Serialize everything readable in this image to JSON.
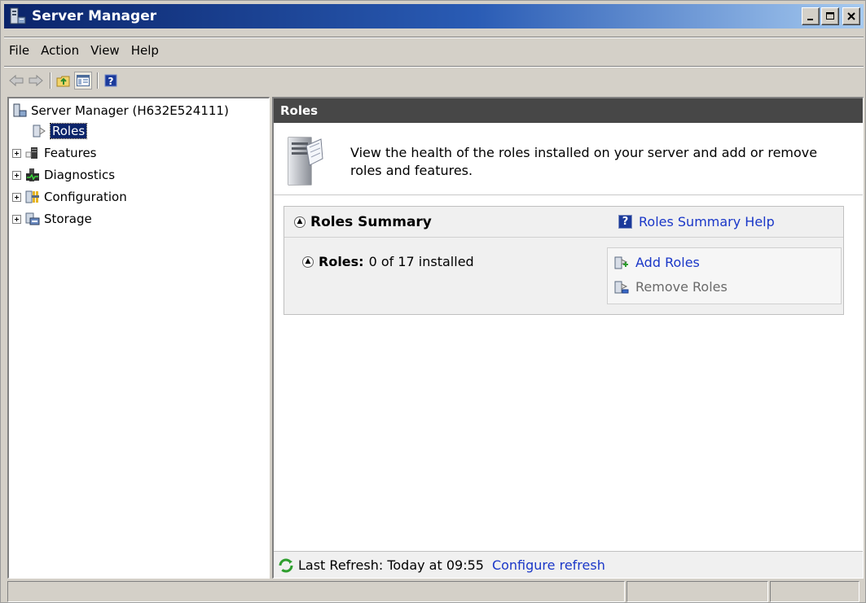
{
  "window": {
    "title": "Server Manager",
    "minimize": "_",
    "maximize": "□",
    "close": "x"
  },
  "menu": [
    "File",
    "Action",
    "View",
    "Help"
  ],
  "toolbar": {
    "buttons": [
      "back-arrow-icon",
      "forward-arrow-icon",
      "up-folder-icon",
      "show-hide-tree-icon",
      "help-icon"
    ]
  },
  "tree": {
    "root": "Server Manager (H632E524111)",
    "items": [
      {
        "label": "Roles",
        "selected": true,
        "expandable": false,
        "icon": "roles-icon"
      },
      {
        "label": "Features",
        "selected": false,
        "expandable": true,
        "icon": "features-icon"
      },
      {
        "label": "Diagnostics",
        "selected": false,
        "expandable": true,
        "icon": "diagnostics-icon"
      },
      {
        "label": "Configuration",
        "selected": false,
        "expandable": true,
        "icon": "configuration-icon"
      },
      {
        "label": "Storage",
        "selected": false,
        "expandable": true,
        "icon": "storage-icon"
      }
    ]
  },
  "content": {
    "header": "Roles",
    "intro": "View the health of the roles installed on your server and add or remove roles and features.",
    "summary": {
      "title": "Roles Summary",
      "help_link": "Roles Summary Help",
      "roles_label": "Roles:",
      "roles_value": "0 of 17 installed",
      "tasks": [
        {
          "label": "Add Roles",
          "enabled": true
        },
        {
          "label": "Remove Roles",
          "enabled": false
        }
      ]
    },
    "footer": {
      "last_refresh": "Last Refresh: Today at 09:55",
      "configure_link": "Configure refresh"
    }
  },
  "colors": {
    "title_gradient_start": "#0a246a",
    "link": "#1a37c8",
    "header_bg": "#474747",
    "selection": "#0a246a"
  }
}
